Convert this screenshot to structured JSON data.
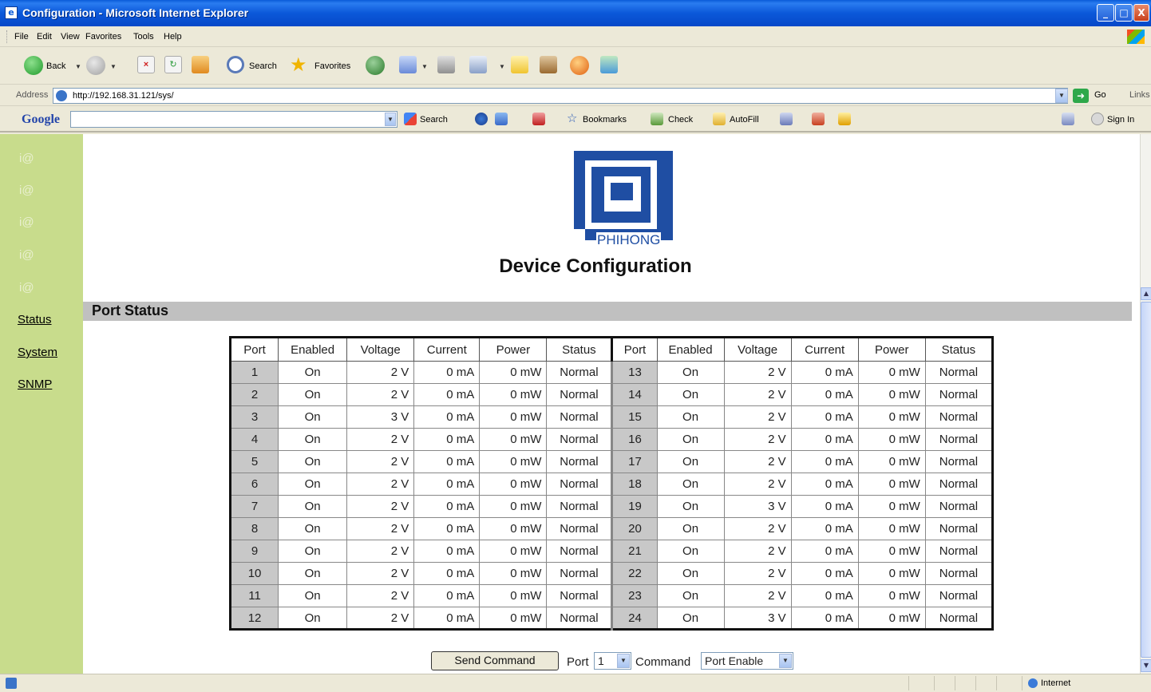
{
  "window": {
    "title": "Configuration - Microsoft Internet Explorer",
    "min_glyph": "_",
    "max_glyph": "□",
    "close_glyph": "X"
  },
  "menu": [
    "File",
    "Edit",
    "View",
    "Favorites",
    "Tools",
    "Help"
  ],
  "toolbar": {
    "back_label": "Back",
    "search_label": "Search",
    "favorites_label": "Favorites"
  },
  "address": {
    "label": "Address",
    "url": "http://192.168.31.121/sys/",
    "go_label": "Go",
    "links_label": "Links"
  },
  "googlebar": {
    "logo": "Google",
    "search_label": "Search",
    "bookmarks_label": "Bookmarks",
    "check_label": "Check",
    "autofill_label": "AutoFill",
    "signin_label": "Sign In"
  },
  "sidebar": {
    "placeholders": [
      "i@",
      "i@",
      "i@",
      "i@",
      "i@"
    ],
    "links": [
      "Status",
      "System",
      "SNMP"
    ]
  },
  "brand": {
    "name": "PHIHONG",
    "primary_color": "#1f4ea3",
    "sidebar_color": "#c8dc8c"
  },
  "page": {
    "title": "Device Configuration",
    "section_heading": "Port Status"
  },
  "table": {
    "headers": [
      "Port",
      "Enabled",
      "Voltage",
      "Current",
      "Power",
      "Status",
      "Port",
      "Enabled",
      "Voltage",
      "Current",
      "Power",
      "Status"
    ],
    "rows": [
      [
        "1",
        "On",
        "2 V",
        "0 mA",
        "0 mW",
        "Normal",
        "13",
        "On",
        "2 V",
        "0 mA",
        "0 mW",
        "Normal"
      ],
      [
        "2",
        "On",
        "2 V",
        "0 mA",
        "0 mW",
        "Normal",
        "14",
        "On",
        "2 V",
        "0 mA",
        "0 mW",
        "Normal"
      ],
      [
        "3",
        "On",
        "3 V",
        "0 mA",
        "0 mW",
        "Normal",
        "15",
        "On",
        "2 V",
        "0 mA",
        "0 mW",
        "Normal"
      ],
      [
        "4",
        "On",
        "2 V",
        "0 mA",
        "0 mW",
        "Normal",
        "16",
        "On",
        "2 V",
        "0 mA",
        "0 mW",
        "Normal"
      ],
      [
        "5",
        "On",
        "2 V",
        "0 mA",
        "0 mW",
        "Normal",
        "17",
        "On",
        "2 V",
        "0 mA",
        "0 mW",
        "Normal"
      ],
      [
        "6",
        "On",
        "2 V",
        "0 mA",
        "0 mW",
        "Normal",
        "18",
        "On",
        "2 V",
        "0 mA",
        "0 mW",
        "Normal"
      ],
      [
        "7",
        "On",
        "2 V",
        "0 mA",
        "0 mW",
        "Normal",
        "19",
        "On",
        "3 V",
        "0 mA",
        "0 mW",
        "Normal"
      ],
      [
        "8",
        "On",
        "2 V",
        "0 mA",
        "0 mW",
        "Normal",
        "20",
        "On",
        "2 V",
        "0 mA",
        "0 mW",
        "Normal"
      ],
      [
        "9",
        "On",
        "2 V",
        "0 mA",
        "0 mW",
        "Normal",
        "21",
        "On",
        "2 V",
        "0 mA",
        "0 mW",
        "Normal"
      ],
      [
        "10",
        "On",
        "2 V",
        "0 mA",
        "0 mW",
        "Normal",
        "22",
        "On",
        "2 V",
        "0 mA",
        "0 mW",
        "Normal"
      ],
      [
        "11",
        "On",
        "2 V",
        "0 mA",
        "0 mW",
        "Normal",
        "23",
        "On",
        "2 V",
        "0 mA",
        "0 mW",
        "Normal"
      ],
      [
        "12",
        "On",
        "2 V",
        "0 mA",
        "0 mW",
        "Normal",
        "24",
        "On",
        "3 V",
        "0 mA",
        "0 mW",
        "Normal"
      ]
    ]
  },
  "controls": {
    "send_button": "Send Command",
    "port_label": "Port",
    "port_value": "1",
    "command_label": "Command",
    "command_value": "Port Enable"
  },
  "statusbar": {
    "zone": "Internet"
  }
}
